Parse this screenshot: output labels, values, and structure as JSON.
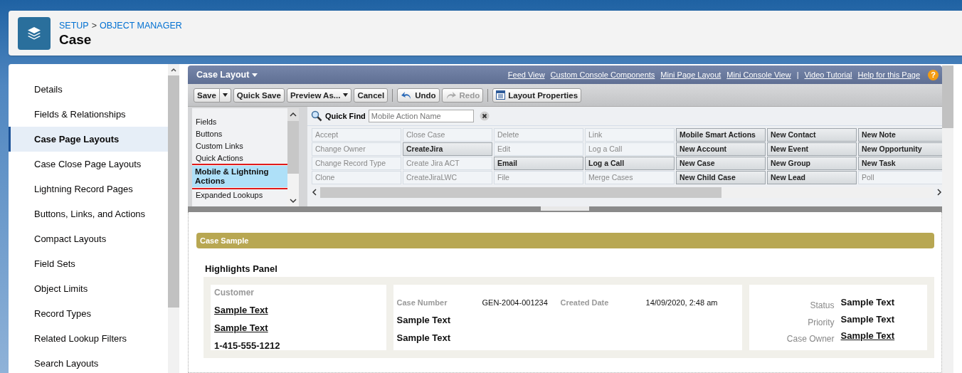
{
  "header": {
    "breadcrumbs": [
      "SETUP",
      "OBJECT MANAGER"
    ],
    "separator": ">",
    "title": "Case"
  },
  "sidebar": {
    "items": [
      {
        "label": "Details",
        "selected": false
      },
      {
        "label": "Fields & Relationships",
        "selected": false
      },
      {
        "label": "Case Page Layouts",
        "selected": true
      },
      {
        "label": "Case Close Page Layouts",
        "selected": false
      },
      {
        "label": "Lightning Record Pages",
        "selected": false
      },
      {
        "label": "Buttons, Links, and Actions",
        "selected": false
      },
      {
        "label": "Compact Layouts",
        "selected": false
      },
      {
        "label": "Field Sets",
        "selected": false
      },
      {
        "label": "Object Limits",
        "selected": false
      },
      {
        "label": "Record Types",
        "selected": false
      },
      {
        "label": "Related Lookup Filters",
        "selected": false
      },
      {
        "label": "Search Layouts",
        "selected": false
      }
    ]
  },
  "editor": {
    "title": "Case Layout",
    "links": [
      "Feed View",
      "Custom Console Components",
      "Mini Page Layout",
      "Mini Console View"
    ],
    "separator": "|",
    "help_links": [
      "Video Tutorial",
      "Help for this Page"
    ],
    "help_icon": "?",
    "toolbar": [
      {
        "label": "Save",
        "kind": "split",
        "disabled": false
      },
      {
        "label": "Quick Save",
        "kind": "plain",
        "disabled": false
      },
      {
        "label": "Preview As...",
        "kind": "dropdown",
        "disabled": false
      },
      {
        "label": "Cancel",
        "kind": "plain",
        "disabled": false
      },
      {
        "label": "Undo",
        "kind": "undo",
        "disabled": false
      },
      {
        "label": "Redo",
        "kind": "redo",
        "disabled": true
      },
      {
        "label": "Layout Properties",
        "kind": "properties",
        "disabled": false
      }
    ],
    "categories": [
      {
        "label": "Fields",
        "selected": false
      },
      {
        "label": "Buttons",
        "selected": false
      },
      {
        "label": "Custom Links",
        "selected": false
      },
      {
        "label": "Quick Actions",
        "selected": false
      },
      {
        "label": "Mobile & Lightning Actions",
        "selected": true
      },
      {
        "label": "Expanded Lookups",
        "selected": false
      }
    ],
    "quick_find": {
      "label": "Quick Find",
      "placeholder": "Mobile Action Name"
    },
    "palette": [
      [
        {
          "label": "Accept",
          "placed": true
        },
        {
          "label": "Close Case",
          "placed": true
        },
        {
          "label": "Delete",
          "placed": true
        },
        {
          "label": "Link",
          "placed": true
        },
        {
          "label": "Mobile Smart Actions",
          "placed": false
        },
        {
          "label": "New Contact",
          "placed": false
        },
        {
          "label": "New Note",
          "placed": false
        }
      ],
      [
        {
          "label": "Change Owner",
          "placed": true
        },
        {
          "label": "CreateJira",
          "placed": false
        },
        {
          "label": "Edit",
          "placed": true
        },
        {
          "label": "Log a Call",
          "placed": true
        },
        {
          "label": "New Account",
          "placed": false
        },
        {
          "label": "New Event",
          "placed": false
        },
        {
          "label": "New Opportunity",
          "placed": false
        }
      ],
      [
        {
          "label": "Change Record Type",
          "placed": true
        },
        {
          "label": "Create Jira ACT",
          "placed": true
        },
        {
          "label": "Email",
          "placed": false
        },
        {
          "label": "Log a Call",
          "placed": false
        },
        {
          "label": "New Case",
          "placed": false
        },
        {
          "label": "New Group",
          "placed": false
        },
        {
          "label": "New Task",
          "placed": false
        }
      ],
      [
        {
          "label": "Clone",
          "placed": true
        },
        {
          "label": "CreateJiraLWC",
          "placed": true
        },
        {
          "label": "File",
          "placed": true
        },
        {
          "label": "Merge Cases",
          "placed": true
        },
        {
          "label": "New Child Case",
          "placed": false
        },
        {
          "label": "New Lead",
          "placed": false
        },
        {
          "label": "Poll",
          "placed": true
        }
      ]
    ]
  },
  "canvas": {
    "section_title": "Case Sample",
    "panel_title": "Highlights Panel",
    "primary": {
      "label": "Customer",
      "values": [
        {
          "text": "Sample Text",
          "link": true
        },
        {
          "text": "Sample Text",
          "link": true
        },
        {
          "text": "1-415-555-1212",
          "link": false
        }
      ]
    },
    "secondary": {
      "fields": [
        {
          "label": "Case Number",
          "value": "GEN-2004-001234"
        },
        {
          "label": "Created Date",
          "value": "14/09/2020, 2:48 am"
        }
      ],
      "values": [
        {
          "text": "Sample Text",
          "link": false
        },
        {
          "text": "Sample Text",
          "link": false
        }
      ]
    },
    "details": [
      {
        "label": "Status",
        "value": "Sample Text",
        "link": false
      },
      {
        "label": "Priority",
        "value": "Sample Text",
        "link": false
      },
      {
        "label": "Case Owner",
        "value": "Sample Text",
        "link": true
      }
    ]
  }
}
